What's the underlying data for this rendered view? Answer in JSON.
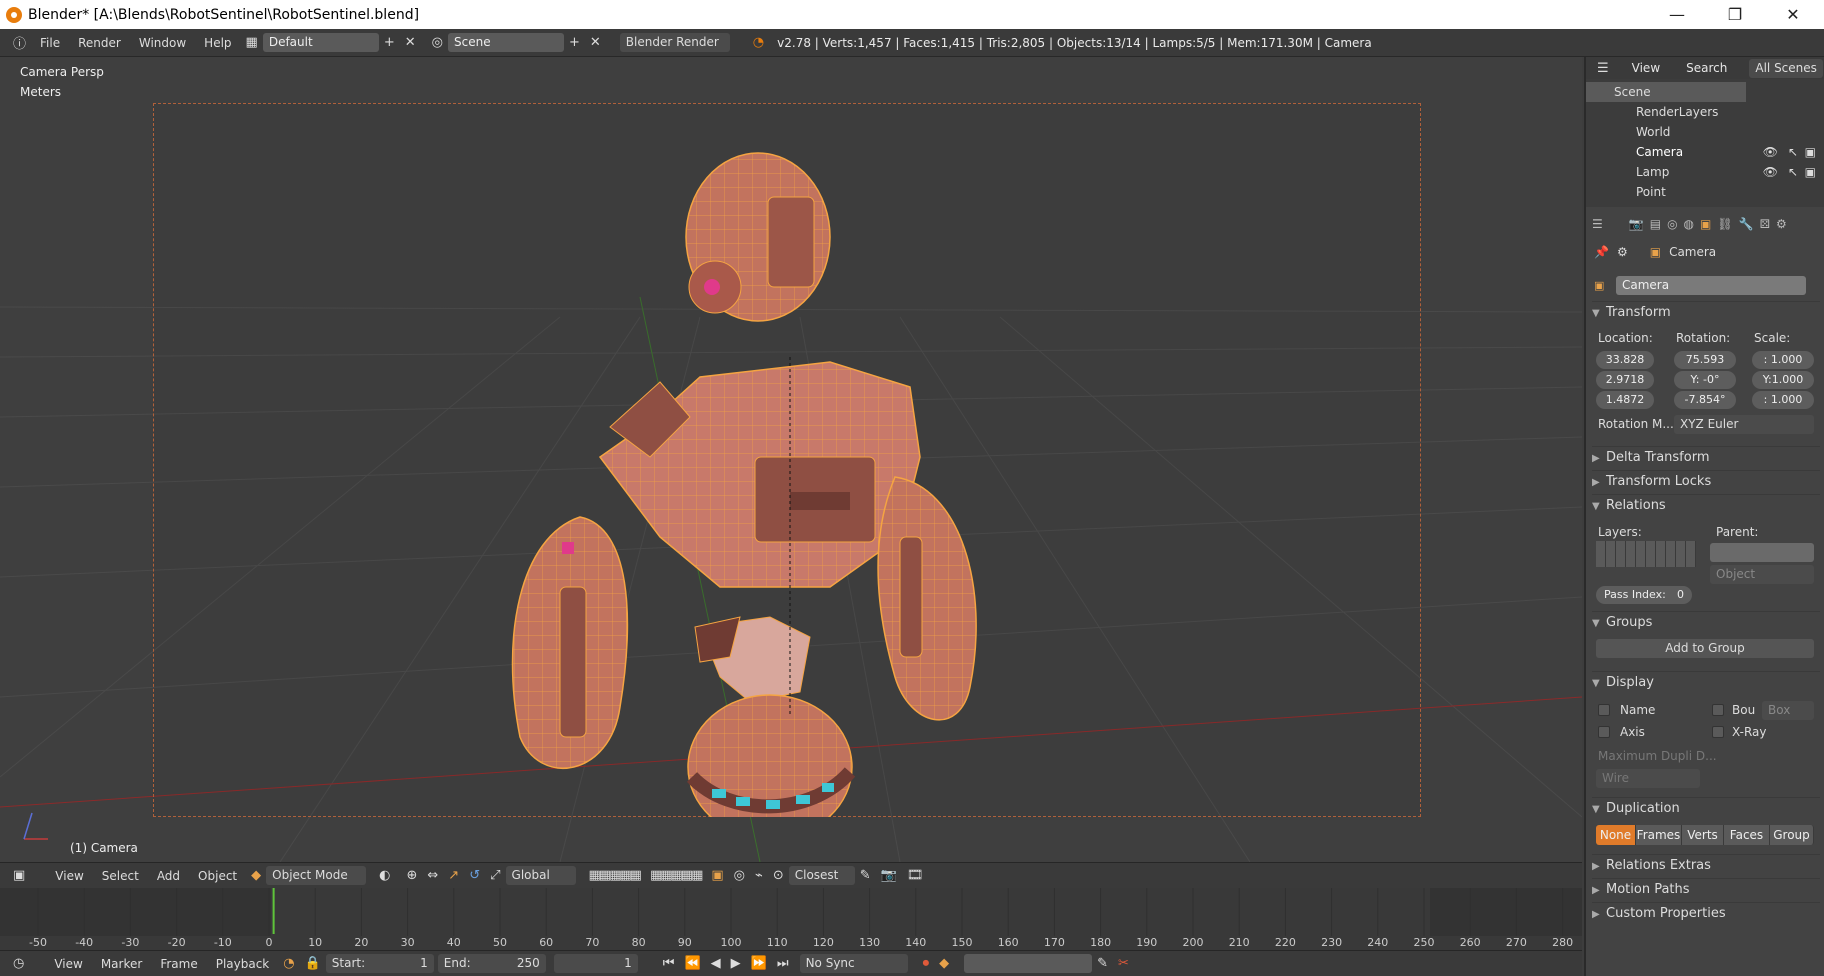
{
  "window": {
    "title": "Blender* [A:\\Blends\\RobotSentinel\\RobotSentinel.blend]",
    "controls": [
      "—",
      "❐",
      "✕"
    ]
  },
  "topbar": {
    "menus": [
      "File",
      "Render",
      "Window",
      "Help"
    ],
    "screen_layout": "Default",
    "scene": "Scene",
    "engine": "Blender Render",
    "stats": "v2.78 | Verts:1,457 | Faces:1,415 | Tris:2,805 | Objects:13/14 | Lamps:5/5 | Mem:171.30M | Camera"
  },
  "viewport": {
    "view_name": "Camera Persp",
    "units": "Meters",
    "object_label": "(1) Camera",
    "header": {
      "menus": [
        "View",
        "Select",
        "Add",
        "Object"
      ],
      "mode": "Object Mode",
      "orientation": "Global",
      "snap": "Closest"
    }
  },
  "timeline": {
    "ticks": [
      "-50",
      "-40",
      "-30",
      "-20",
      "-10",
      "0",
      "10",
      "20",
      "30",
      "40",
      "50",
      "60",
      "70",
      "80",
      "90",
      "100",
      "110",
      "120",
      "130",
      "140",
      "150",
      "160",
      "170",
      "180",
      "190",
      "200",
      "210",
      "220",
      "230",
      "240",
      "250",
      "260",
      "270",
      "280"
    ],
    "current_frame": 1,
    "footer": {
      "menus": [
        "View",
        "Marker",
        "Frame",
        "Playback"
      ],
      "start_label": "Start:",
      "start_value": "1",
      "end_label": "End:",
      "end_value": "250",
      "frame_value": "1",
      "sync": "No Sync"
    }
  },
  "outliner": {
    "tabs": [
      "View",
      "Search",
      "All Scenes"
    ],
    "items": [
      {
        "label": "Scene"
      },
      {
        "label": "RenderLayers"
      },
      {
        "label": "World"
      },
      {
        "label": "Camera"
      },
      {
        "label": "Lamp"
      },
      {
        "label": "Point"
      }
    ]
  },
  "properties": {
    "context_label": "Camera",
    "object_name": "Camera",
    "transform": {
      "title": "Transform",
      "location_label": "Location:",
      "rotation_label": "Rotation:",
      "scale_label": "Scale:",
      "location": [
        "33.828",
        "2.9718",
        "1.4872"
      ],
      "rotation": [
        "75.593",
        "Y: -0°",
        "-7.854°"
      ],
      "scale": [
        ": 1.000",
        "Y:1.000",
        ": 1.000"
      ],
      "rotation_mode_label": "Rotation M...",
      "rotation_mode": "XYZ Euler"
    },
    "panels": {
      "delta": "Delta Transform",
      "locks": "Transform Locks",
      "relations": "Relations",
      "groups": "Groups",
      "display": "Display",
      "duplication": "Duplication",
      "relations_extras": "Relations Extras",
      "motion_paths": "Motion Paths",
      "custom_props": "Custom Properties"
    },
    "relations": {
      "layers_label": "Layers:",
      "parent_label": "Parent:",
      "parent_type": "Object",
      "pass_index_label": "Pass Index:",
      "pass_index": "0"
    },
    "groups": {
      "add_button": "Add to Group"
    },
    "display": {
      "name": "Name",
      "bounds": "Bou",
      "bounds_type": "Box",
      "axis": "Axis",
      "xray": "X-Ray",
      "max_dupli": "Maximum Dupli D...",
      "wire": "Wire"
    },
    "duplication": {
      "options": [
        "None",
        "Frames",
        "Verts",
        "Faces",
        "Group"
      ]
    }
  },
  "colors": {
    "accent": "#e87d0d",
    "selected_outline": "#f5a442",
    "robot": "#c2735e"
  }
}
